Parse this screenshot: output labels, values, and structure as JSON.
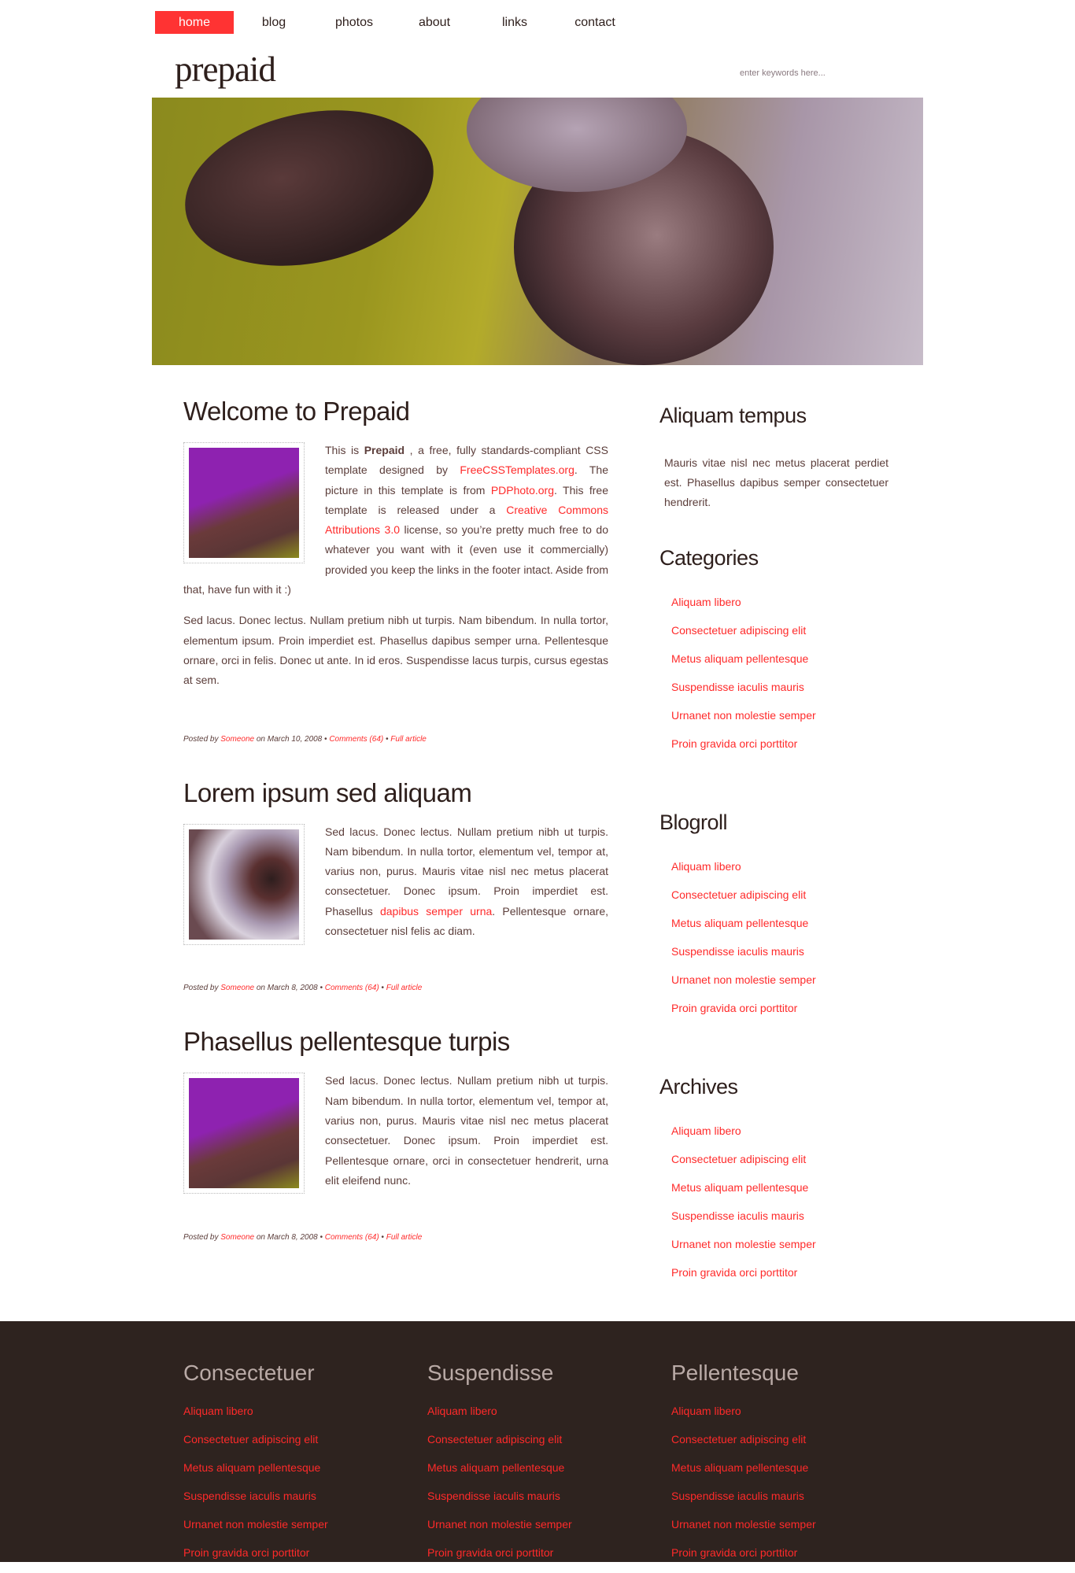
{
  "nav": {
    "items": [
      {
        "label": "home",
        "active": true
      },
      {
        "label": "blog"
      },
      {
        "label": "photos"
      },
      {
        "label": "about"
      },
      {
        "label": "links"
      },
      {
        "label": "contact"
      }
    ]
  },
  "header": {
    "logo": "prepaid",
    "search_placeholder": "enter keywords here..."
  },
  "colors": {
    "accent": "#ff3333",
    "link": "#ff2a2a",
    "text": "#5b3d3a",
    "heading": "#2e1f1c",
    "footer_bg": "#2e231f"
  },
  "posts": [
    {
      "title": "Welcome to Prepaid",
      "thumb": "purple-flower",
      "paragraphs": [
        [
          {
            "t": "This is "
          },
          {
            "t": "Prepaid",
            "b": true
          },
          {
            "t": " , a free, fully standards-compliant CSS template designed by "
          },
          {
            "t": "FreeCSSTemplates.org",
            "link": true
          },
          {
            "t": ".  The picture in this template is from "
          },
          {
            "t": "PDPhoto.org",
            "link": true
          },
          {
            "t": ". This free template is released under a "
          },
          {
            "t": "Creative Commons Attributions 3.0",
            "link": true
          },
          {
            "t": " license, so you’re pretty much free to do whatever you want with it (even use it commercially) provided you keep the links in the footer intact. Aside from that, have fun with it :)"
          }
        ],
        [
          {
            "t": "Sed lacus. Donec lectus. Nullam pretium nibh ut turpis. Nam bibendum. In nulla tortor, elementum ipsum. Proin imperdiet est. Phasellus dapibus semper urna. Pellentesque ornare, orci in felis. Donec ut ante. In id eros. Suspendisse lacus turpis, cursus egestas at sem."
          }
        ]
      ],
      "meta": {
        "posted_by": "Posted by",
        "author": "Someone",
        "date": "on March 10, 2008",
        "comments": "Comments (64)",
        "full": "Full article"
      }
    },
    {
      "title": "Lorem ipsum sed aliquam",
      "thumb": "white-flower",
      "paragraphs": [
        [
          {
            "t": "Sed lacus. Donec lectus. Nullam pretium nibh ut turpis. Nam bibendum. In nulla tortor, elementum vel, tempor at, varius non, purus. Mauris vitae nisl nec metus placerat consectetuer. Donec ipsum. Proin imperdiet est. Phasellus "
          },
          {
            "t": "dapibus semper urna",
            "link": true
          },
          {
            "t": ". Pellentesque ornare, consectetuer nisl felis ac diam."
          }
        ]
      ],
      "meta": {
        "posted_by": "Posted by",
        "author": "Someone",
        "date": "on March 8, 2008",
        "comments": "Comments (64)",
        "full": "Full article"
      }
    },
    {
      "title": "Phasellus pellentesque turpis",
      "thumb": "purple-flower",
      "paragraphs": [
        [
          {
            "t": "Sed lacus. Donec lectus. Nullam pretium nibh ut turpis. Nam bibendum. In nulla tortor, elementum vel, tempor at, varius non, purus. Mauris vitae nisl nec metus placerat consectetuer. Donec ipsum. Proin imperdiet est. Pellentesque ornare, orci in consectetuer hendrerit, urna elit eleifend nunc."
          }
        ]
      ],
      "meta": {
        "posted_by": "Posted by",
        "author": "Someone",
        "date": "on March 8, 2008",
        "comments": "Comments (64)",
        "full": "Full article"
      }
    }
  ],
  "sidebar": {
    "about": {
      "title": "Aliquam tempus",
      "text": "Mauris vitae nisl nec metus placerat perdiet est. Phasellus dapibus semper consectetuer hendrerit."
    },
    "lists": [
      {
        "title": "Categories",
        "items": [
          "Aliquam libero",
          "Consectetuer adipiscing elit",
          "Metus aliquam pellentesque",
          "Suspendisse iaculis mauris",
          "Urnanet non molestie semper",
          "Proin gravida orci porttitor"
        ]
      },
      {
        "title": "Blogroll",
        "items": [
          "Aliquam libero",
          "Consectetuer adipiscing elit",
          "Metus aliquam pellentesque",
          "Suspendisse iaculis mauris",
          "Urnanet non molestie semper",
          "Proin gravida orci porttitor"
        ]
      },
      {
        "title": "Archives",
        "items": [
          "Aliquam libero",
          "Consectetuer adipiscing elit",
          "Metus aliquam pellentesque",
          "Suspendisse iaculis mauris",
          "Urnanet non molestie semper",
          "Proin gravida orci porttitor"
        ]
      }
    ]
  },
  "footer": {
    "columns": [
      {
        "title": "Consectetuer",
        "items": [
          "Aliquam libero",
          "Consectetuer adipiscing elit",
          "Metus aliquam pellentesque",
          "Suspendisse iaculis mauris",
          "Urnanet non molestie semper",
          "Proin gravida orci porttitor"
        ]
      },
      {
        "title": "Suspendisse",
        "items": [
          "Aliquam libero",
          "Consectetuer adipiscing elit",
          "Metus aliquam pellentesque",
          "Suspendisse iaculis mauris",
          "Urnanet non molestie semper",
          "Proin gravida orci porttitor"
        ]
      },
      {
        "title": "Pellentesque",
        "items": [
          "Aliquam libero",
          "Consectetuer adipiscing elit",
          "Metus aliquam pellentesque",
          "Suspendisse iaculis mauris",
          "Urnanet non molestie semper",
          "Proin gravida orci porttitor"
        ]
      }
    ]
  }
}
